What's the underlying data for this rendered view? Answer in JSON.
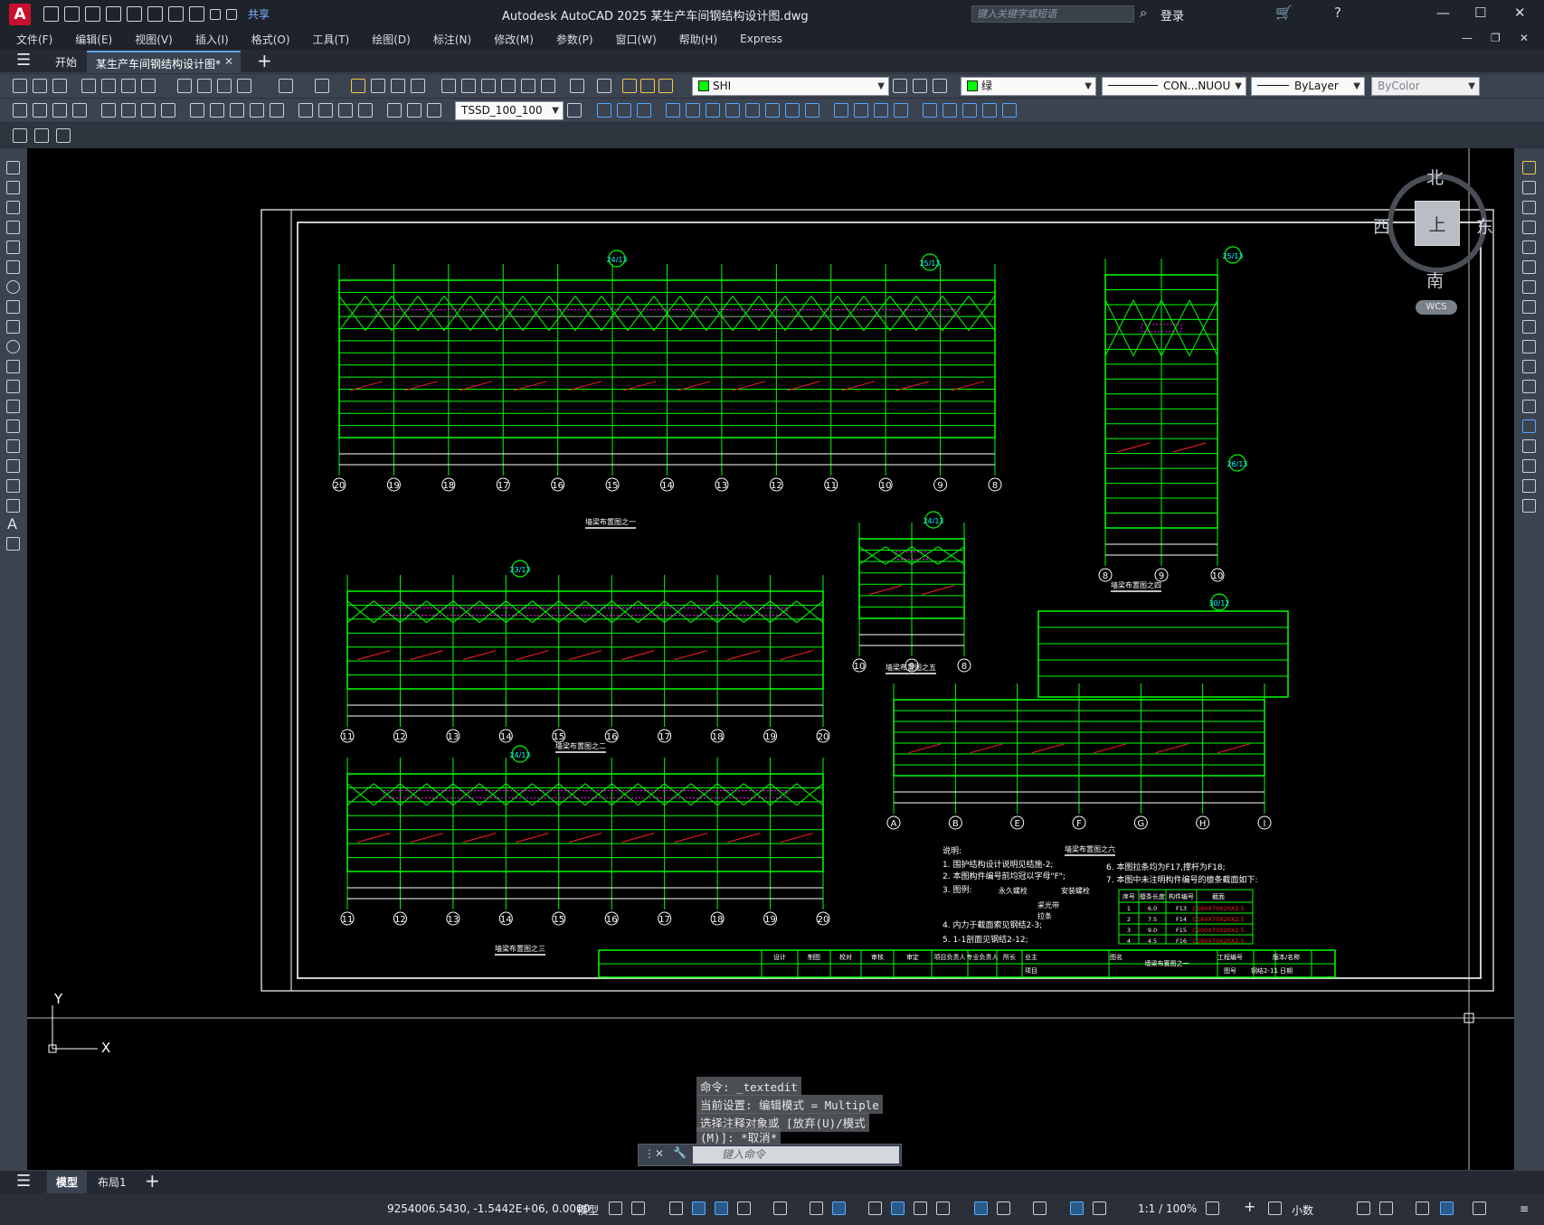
{
  "app": {
    "logo_letter": "A",
    "title": "Autodesk AutoCAD 2025    某生产车间钢结构设计图.dwg",
    "share_label": "共享",
    "search_placeholder": "键入关键字或短语",
    "login_label": "登录"
  },
  "menu": [
    "文件(F)",
    "编辑(E)",
    "视图(V)",
    "插入(I)",
    "格式(O)",
    "工具(T)",
    "绘图(D)",
    "标注(N)",
    "修改(M)",
    "参数(P)",
    "窗口(W)",
    "帮助(H)",
    "Express"
  ],
  "doc_tabs": {
    "start": "开始",
    "active": "某生产车间钢结构设计图*"
  },
  "properties": {
    "layer": "SHI",
    "color": "绿",
    "linetype": "CON...NUOU",
    "lineweight": "ByLayer",
    "plotstyle": "ByColor",
    "dimstyle": "TSSD_100_100",
    "color_hex": "#00ff00"
  },
  "viewcube": {
    "north": "北",
    "south": "南",
    "east": "东",
    "west": "西",
    "face": "上",
    "wcs": "WCS"
  },
  "ucs": {
    "x": "X",
    "y": "Y"
  },
  "command_history": [
    "命令: _textedit",
    "当前设置: 编辑模式 = Multiple",
    "选择注释对象或 [放弃(U)/模式",
    "(M)]: *取消*"
  ],
  "command_input_placeholder": "键入命令",
  "layout_tabs": {
    "model": "模型",
    "layout1": "布局1"
  },
  "status": {
    "coords": "9254006.5430, -1.5442E+06, 0.0000",
    "model_label": "模型",
    "scale": "1:1 / 100%",
    "units": "小数"
  },
  "drawing": {
    "titles": [
      "墙梁布置图之一",
      "墙梁布置图之二",
      "墙梁布置图之三",
      "墙梁布置图之四",
      "墙梁布置图之五",
      "墙梁布置图之六"
    ],
    "grid_top": [
      "20",
      "19",
      "18",
      "17",
      "16",
      "15",
      "14",
      "13",
      "12",
      "11",
      "10",
      "9",
      "8"
    ],
    "grid_mid": [
      "11",
      "12",
      "13",
      "14",
      "15",
      "16",
      "17",
      "18",
      "19",
      "20"
    ],
    "grid_bot": [
      "11",
      "12",
      "13",
      "14",
      "15",
      "16",
      "17",
      "18",
      "19",
      "20"
    ],
    "grid_right": [
      "8",
      "9",
      "10"
    ],
    "grid_small": [
      "10",
      "9",
      "8"
    ],
    "grid_letters": [
      "A",
      "B",
      "E",
      "F",
      "G",
      "H",
      "I"
    ],
    "notes_title": "说明:",
    "notes": [
      "1. 围护结构设计说明见结施-2;",
      "2. 本图构件编号前均冠以字母\"F\";",
      "3. 图例:",
      "4. 内力于截面索见钢结2-3;",
      "5. 1-1剖面见钢结2-12;"
    ],
    "notes_right": [
      "6. 本图拉条均为F17,撑杆为F18;",
      "7. 本图中未注明构件编号的檩条截面如下:"
    ],
    "legend": [
      "永久螺栓",
      "安装螺栓",
      "采光带",
      "拉条"
    ],
    "table_header": [
      "序号",
      "檩条长度",
      "构件编号",
      "截面"
    ],
    "table_rows": [
      [
        "1",
        "6.0",
        "F13",
        "C160X70X20X2.5"
      ],
      [
        "2",
        "7.5",
        "F14",
        "C160X70X20X2.5"
      ],
      [
        "3",
        "9.0",
        "F15",
        "C200X70X20X2.5"
      ],
      [
        "4",
        "4.5",
        "F16",
        "C160X70X20X2.5"
      ]
    ],
    "titleblock": [
      "设计",
      "制图",
      "校对",
      "审核",
      "审定",
      "项目负责人",
      "专业负责人",
      "所长",
      "业主",
      "项目",
      "图名",
      "墙梁布置图之一",
      "工程编号",
      "图号",
      "钢结2-11",
      "版本/名称",
      "日期"
    ],
    "callouts": [
      "24/13",
      "25/13",
      "25/13",
      "23/13",
      "24/13",
      "30/12",
      "24/13",
      "26/13"
    ]
  }
}
